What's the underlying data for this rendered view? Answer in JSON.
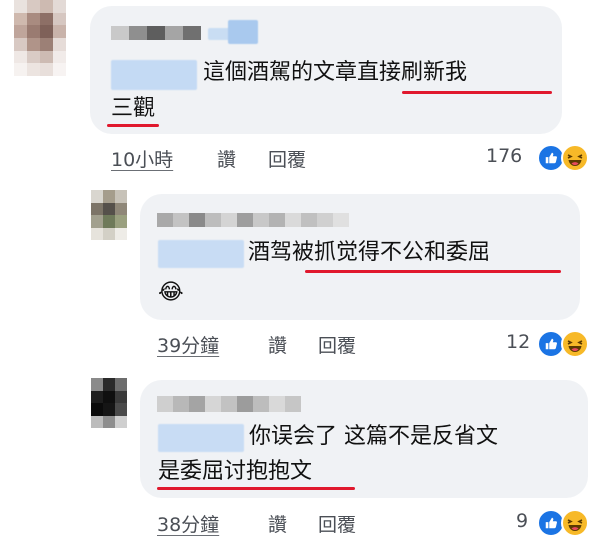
{
  "comments": [
    {
      "text_line1": "這個酒駕的文章直接刷新我",
      "text_line2": "三觀",
      "time": "10小時",
      "like_label": "讚",
      "reply_label": "回覆",
      "reaction_count": "176"
    },
    {
      "text_line1": "酒驾被抓觉得不公和委屈",
      "emoji": "😂",
      "time": "39分鐘",
      "like_label": "讚",
      "reply_label": "回覆",
      "reaction_count": "12"
    },
    {
      "text_line1": "你误会了 这篇不是反省文",
      "text_line2": "是委屈讨抱抱文",
      "time": "38分鐘",
      "like_label": "讚",
      "reply_label": "回覆",
      "reaction_count": "9"
    }
  ],
  "reactions": [
    "like-icon",
    "haha-icon"
  ],
  "colors": {
    "bubble": "#f0f2f5",
    "underline": "#e0182d",
    "like": "#1b74e4",
    "haha": "#f7b928"
  }
}
